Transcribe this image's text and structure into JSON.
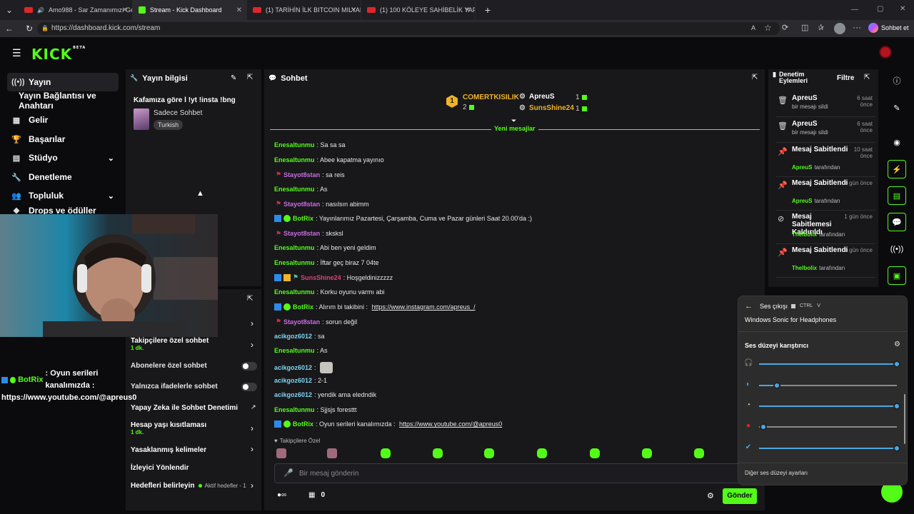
{
  "browser": {
    "tabs": [
      {
        "title": "Amo988 - Sar Zamanımızı Ge",
        "kind": "youtube"
      },
      {
        "title": "Stream - Kick Dashboard",
        "kind": "kick"
      },
      {
        "title": "(1) TARİHİN İLK BITCOIN MILYARD",
        "kind": "youtube"
      },
      {
        "title": "(1) 100 KÖLEYE SAHİBELİK YAPTIM",
        "kind": "youtube"
      }
    ],
    "url": "https://dashboard.kick.com/stream",
    "chat_button": "Sohbet et"
  },
  "app": {
    "logo": "KICK",
    "logo_badge": "BETA"
  },
  "sidebar": {
    "items": [
      {
        "label": "Yayın",
        "icon": "broadcast-icon"
      },
      {
        "label": "Yayın Bağlantısı ve Anahtarı",
        "icon": ""
      },
      {
        "label": "Gelir",
        "icon": "revenue-icon"
      },
      {
        "label": "Başarılar",
        "icon": "trophy-icon"
      },
      {
        "label": "Stüdyo",
        "icon": "studio-icon"
      },
      {
        "label": "Denetleme",
        "icon": "wrench-icon"
      },
      {
        "label": "Topluluk",
        "icon": "community-icon"
      },
      {
        "label": "Drops ve ödüller",
        "icon": "drops-icon"
      }
    ]
  },
  "stream_info": {
    "title": "Yayın bilgisi",
    "stream_title": "Kafamıza göre l !yt !insta !bng",
    "category": "Sadece Sohbet",
    "language": "Turkish"
  },
  "chat_settings": {
    "rows": [
      {
        "label": "Takipçilere özel sohbet",
        "sub": "1 dk.",
        "control": "chevron"
      },
      {
        "label": "Abonelere özel sohbet",
        "sub": "",
        "control": "toggle"
      },
      {
        "label": "Yalnızca ifadelerle sohbet",
        "sub": "",
        "control": "toggle"
      },
      {
        "label": "Yapay Zeka ile Sohbet Denetimi",
        "sub": "",
        "control": "external"
      },
      {
        "label": "Hesap yaşı kısıtlaması",
        "sub": "1 dk.",
        "control": "chevron"
      },
      {
        "label": "Yasaklanmış kelimeler",
        "sub": "",
        "control": "chevron"
      },
      {
        "label": "İzleyici Yönlendir",
        "sub": "",
        "control": "none"
      },
      {
        "label": "Hedefleri belirleyin",
        "sub": "",
        "control": "chevron"
      }
    ],
    "goals_status": "Aktif hedefler - 1"
  },
  "overlay_chat": {
    "user": "BotRix",
    "line1": ": Oyun serileri kanalımızda :",
    "line2": "https://www.youtube.com/@apreus0"
  },
  "chat": {
    "title": "Sohbet",
    "leaderboard": [
      {
        "rank": "1",
        "name": "COMERTKISILIK",
        "count": "2"
      },
      {
        "rank": "",
        "name": "ApreuS",
        "count": "1"
      },
      {
        "rank": "",
        "name": "SunsShine24",
        "count": "1"
      }
    ],
    "new_messages": "Yeni mesajlar",
    "messages": [
      {
        "user": "Enesaltunmu",
        "text": ": Sa sa sa",
        "color": "#53fc18"
      },
      {
        "user": "Enesaltunmu",
        "text": ": Abee kapatma yayınıo",
        "color": "#53fc18"
      },
      {
        "user": "Stayot8stan",
        "text": ": sa reis",
        "color": "#c86ce0"
      },
      {
        "user": "Enesaltunmu",
        "text": ": As",
        "color": "#53fc18"
      },
      {
        "user": "Stayot8stan",
        "text": ": nasılsın abimm",
        "color": "#c86ce0"
      },
      {
        "user": "BotRix",
        "text": ": Yayınlarımız Pazartesi, Çarşamba, Cuma ve Pazar günleri Saat 20.00'da :)",
        "color": "#53fc18"
      },
      {
        "user": "Stayot8stan",
        "text": ": sksksl",
        "color": "#c86ce0"
      },
      {
        "user": "Enesaltunmu",
        "text": ": Abi ben yeni geldim",
        "color": "#53fc18"
      },
      {
        "user": "Enesaltunmu",
        "text": ": İftar geç biraz 7 04te",
        "color": "#53fc18"
      },
      {
        "user": "SunsShine24",
        "text": ": Hoşgeldinizzzzz",
        "color": "#e0407a"
      },
      {
        "user": "Enesaltunmu",
        "text": ": Korku oyunu varmı abi",
        "color": "#53fc18"
      },
      {
        "user": "BotRix",
        "text": ": Alırım bi takibini : ",
        "link": "https://www.instagram.com/apreus_/",
        "color": "#53fc18"
      },
      {
        "user": "Stayot8stan",
        "text": ": sorun değil",
        "color": "#c86ce0"
      },
      {
        "user": "acikgoz6012",
        "text": ": sa",
        "color": "#7fd4f0"
      },
      {
        "user": "Enesaltunmu",
        "text": ": As",
        "color": "#53fc18"
      },
      {
        "user": "acikgoz6012",
        "text": ":",
        "color": "#7fd4f0"
      },
      {
        "user": "acikgoz6012",
        "text": ": 2-1",
        "color": "#7fd4f0"
      },
      {
        "user": "acikgoz6012",
        "text": ": yendik ama eledndik",
        "color": "#7fd4f0"
      },
      {
        "user": "Enesaltunmu",
        "text": ": Sjjsjs foresttt",
        "color": "#53fc18"
      },
      {
        "user": "BotRix",
        "text": ": Oyun serileri kanalımızda : ",
        "link": "https://www.youtube.com/@apreus0",
        "color": "#53fc18"
      }
    ],
    "followers_only": "Takipçilere Özel",
    "input_placeholder": "Bir mesaj gönderin",
    "points": "0",
    "send": "Gönder"
  },
  "mod_log": {
    "title": "Denetim Eylemleri",
    "filter": "Filtre",
    "items": [
      {
        "title": "ApreuS",
        "sub": "bir mesajı sildi",
        "by": "",
        "time": "6 saat önce",
        "icon": "trash-icon"
      },
      {
        "title": "ApreuS",
        "sub": "bir mesajı sildi",
        "by": "",
        "time": "6 saat önce",
        "icon": "trash-icon"
      },
      {
        "title": "Mesaj Sabitlendi",
        "sub": "tarafından",
        "by": "ApreuS",
        "time": "10 saat önce",
        "icon": "pin-icon"
      },
      {
        "title": "Mesaj Sabitlendi",
        "sub": "tarafından",
        "by": "ApreuS",
        "time": "1 gün önce",
        "icon": "pin-icon"
      },
      {
        "title": "Mesaj Sabitlemesi Kaldırıldı",
        "sub": "tarafından",
        "by": "Thelbolix",
        "time": "1 gün önce",
        "icon": "unpin-icon"
      },
      {
        "title": "Mesaj Sabitlendi",
        "sub": "tarafından",
        "by": "Thelbolix",
        "time": "1 gün önce",
        "icon": "pin-icon"
      }
    ]
  },
  "volume_mixer": {
    "output_label": "Ses çıkışı",
    "shortcut_ctrl": "CTRL",
    "shortcut_v": "V",
    "device": "Windows Sonic for Headphones",
    "mixer_title": "Ses düzeyi karıştırıcı",
    "footer": "Diğer ses düzeyi ayarları",
    "channels": [
      {
        "icon": "headphones-icon",
        "level": 1.0
      },
      {
        "icon": "edge-icon",
        "level": 0.13
      },
      {
        "icon": "system-icon",
        "level": 1.0
      },
      {
        "icon": "youtube-app-icon",
        "level": 0.03
      },
      {
        "icon": "app-icon",
        "level": 1.0
      }
    ]
  },
  "colors": {
    "kick_green": "#53fc18",
    "accent_blue": "#4aa8e0"
  }
}
